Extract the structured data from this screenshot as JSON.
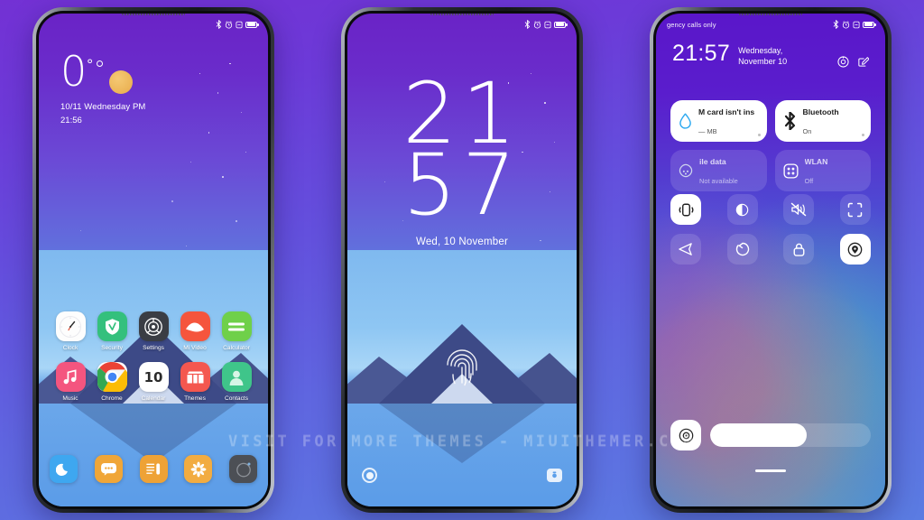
{
  "watermark": "VISIT FOR MORE THEMES - MIUITHEMER.COM",
  "status_bar": {
    "icons": [
      "bluetooth-icon",
      "alarm-icon",
      "dnd-icon",
      "battery-icon"
    ],
    "emergency_text": "gency calls only"
  },
  "phone1": {
    "name": "home-screen",
    "weather": {
      "temperature": "0",
      "degree": "°",
      "date": "10/11 Wednesday PM",
      "time": "21:56"
    },
    "apps_row1": [
      {
        "label": "Clock",
        "icon": "clock-icon",
        "color": "#ffffff"
      },
      {
        "label": "Security",
        "icon": "shield-icon",
        "color": "#34c07d"
      },
      {
        "label": "Settings",
        "icon": "gear-icon",
        "color": "#3a3d44"
      },
      {
        "label": "Mi Video",
        "icon": "video-icon",
        "color": "#f5553d"
      },
      {
        "label": "Calculator",
        "icon": "equals-icon",
        "color": "#6fd04a"
      }
    ],
    "apps_row2": [
      {
        "label": "Music",
        "icon": "music-note-icon",
        "color": "#f4557f"
      },
      {
        "label": "Chrome",
        "icon": "chrome-icon",
        "color": "#ffffff"
      },
      {
        "label": "Calendar",
        "icon": "calendar-icon",
        "color": "#ffffff",
        "day": "10"
      },
      {
        "label": "Themes",
        "icon": "themes-icon",
        "color": "#f4574f"
      },
      {
        "label": "Contacts",
        "icon": "person-icon",
        "color": "#3fc58a"
      }
    ],
    "dock": [
      {
        "label": "Weather",
        "icon": "moon-icon",
        "color": "#3ea7f0"
      },
      {
        "label": "Messages",
        "icon": "messages-icon",
        "color": "#f0a638"
      },
      {
        "label": "Notes",
        "icon": "notes-icon",
        "color": "#eea236"
      },
      {
        "label": "Gallery",
        "icon": "flower-icon",
        "color": "#f2ac41"
      },
      {
        "label": "Camera",
        "icon": "camera-icon",
        "color": "#4c4f55"
      }
    ]
  },
  "phone2": {
    "name": "lock-screen",
    "hours": "21",
    "minutes": "57",
    "date": "Wed, 10 November",
    "fingerprint_icon": "fingerprint-icon",
    "bottom_left_icon": "record-circle-icon",
    "bottom_right_icon": "camera-icon"
  },
  "phone3": {
    "name": "control-center",
    "time": "21:57",
    "date": "Wednesday, November 10",
    "header_icons": [
      "settings-gear-icon",
      "edit-pencil-icon"
    ],
    "tiles": [
      {
        "title": "M card isn't ins",
        "subtitle": "— MB",
        "icon": "water-drop-icon",
        "state": "on"
      },
      {
        "title": "Bluetooth",
        "subtitle": "On",
        "icon": "bluetooth-8-icon",
        "state": "on"
      },
      {
        "title": "ile data",
        "subtitle": "Not available",
        "icon": "mobile-data-icon",
        "state": "off"
      },
      {
        "title": "WLAN",
        "subtitle": "Off",
        "icon": "wlan-grid-icon",
        "state": "off"
      }
    ],
    "toggles_row1": [
      {
        "icon": "auto-rotate-icon",
        "state": "on"
      },
      {
        "icon": "brightness-icon",
        "state": "off"
      },
      {
        "icon": "mute-icon",
        "state": "off"
      },
      {
        "icon": "screenshot-icon",
        "state": "off"
      }
    ],
    "toggles_row2": [
      {
        "icon": "airplane-icon",
        "state": "off"
      },
      {
        "icon": "sync-icon",
        "state": "off"
      },
      {
        "icon": "lock-icon",
        "state": "off"
      },
      {
        "icon": "location-icon",
        "state": "on"
      }
    ],
    "brightness_toggle": {
      "icon": "flashlight-target-icon",
      "state": "on"
    },
    "brightness_percent": 60
  }
}
